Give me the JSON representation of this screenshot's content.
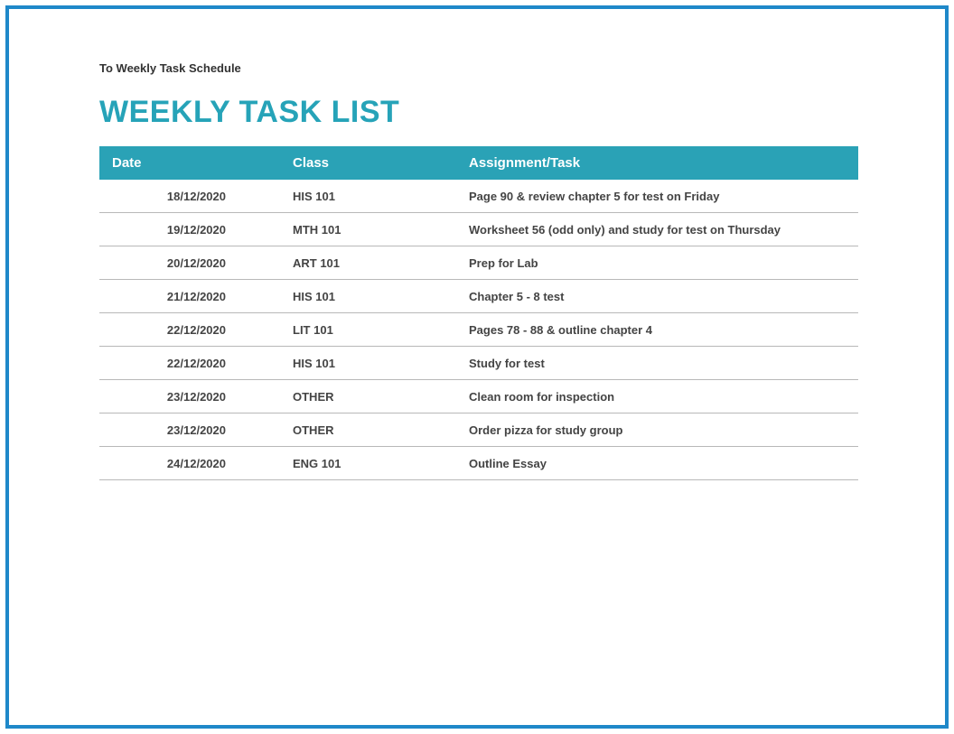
{
  "breadcrumb": "To Weekly Task Schedule",
  "title": "WEEKLY TASK LIST",
  "columns": {
    "date": "Date",
    "class": "Class",
    "task": "Assignment/Task"
  },
  "rows": [
    {
      "date": "18/12/2020",
      "class": "HIS 101",
      "task": "Page 90 & review chapter 5 for test on Friday"
    },
    {
      "date": "19/12/2020",
      "class": "MTH 101",
      "task": "Worksheet 56 (odd only) and study for test on Thursday"
    },
    {
      "date": "20/12/2020",
      "class": "ART 101",
      "task": "Prep for Lab"
    },
    {
      "date": "21/12/2020",
      "class": "HIS 101",
      "task": "Chapter 5 - 8 test"
    },
    {
      "date": "22/12/2020",
      "class": "LIT 101",
      "task": "Pages 78 - 88 & outline chapter 4"
    },
    {
      "date": "22/12/2020",
      "class": "HIS 101",
      "task": "Study for test"
    },
    {
      "date": "23/12/2020",
      "class": "OTHER",
      "task": "Clean room for inspection"
    },
    {
      "date": "23/12/2020",
      "class": "OTHER",
      "task": "Order pizza for study group"
    },
    {
      "date": "24/12/2020",
      "class": "ENG 101",
      "task": "Outline Essay"
    }
  ]
}
